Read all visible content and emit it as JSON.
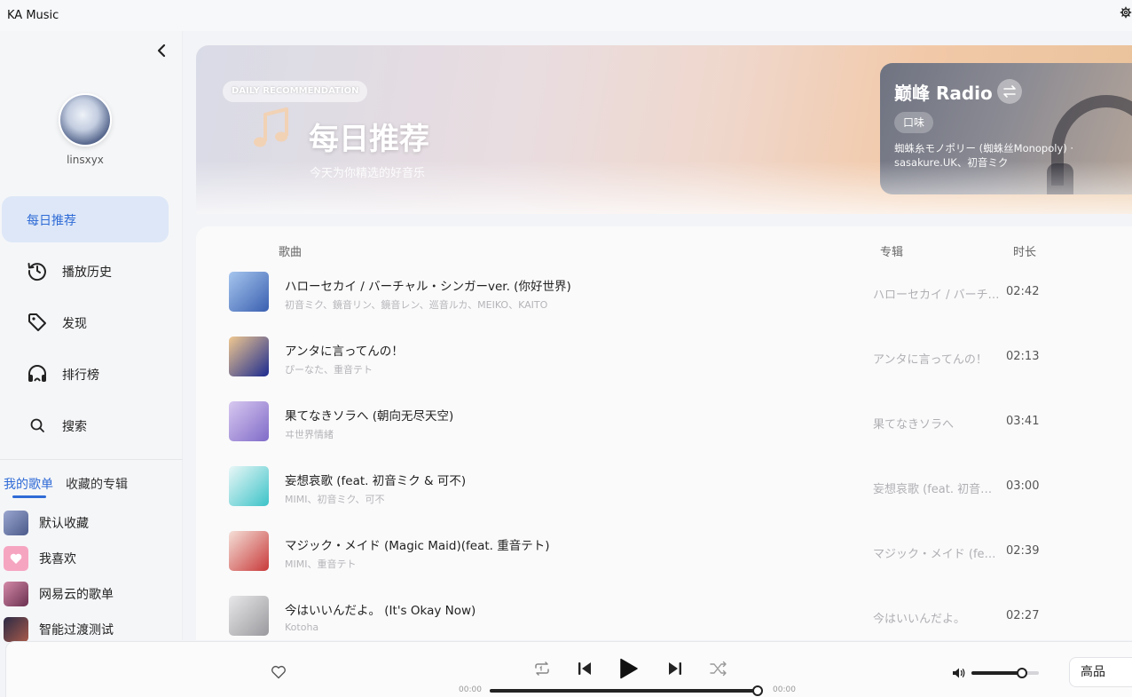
{
  "window": {
    "title": "KA Music"
  },
  "sidebar": {
    "username": "linsxyx",
    "nav": [
      {
        "label": "每日推荐",
        "icon": "none",
        "active": true
      },
      {
        "label": "播放历史",
        "icon": "history-icon"
      },
      {
        "label": "发现",
        "icon": "tag-icon"
      },
      {
        "label": "排行榜",
        "icon": "headset-icon"
      },
      {
        "label": "搜索",
        "icon": "search-icon"
      }
    ],
    "library_tabs": [
      {
        "label": "我的歌单",
        "active": true
      },
      {
        "label": "收藏的专辑"
      }
    ],
    "playlists": [
      {
        "name": "默认收藏",
        "thumb_color": "#6b7aa8"
      },
      {
        "name": "我喜欢",
        "thumb_color": "#f28bb0"
      },
      {
        "name": "网易云的歌单",
        "thumb_color": "#8a4a6e"
      },
      {
        "name": "智能过渡测试",
        "thumb_color": "#3b3a58"
      }
    ]
  },
  "banner": {
    "badge": "DAILY RECOMMENDATION",
    "title": "每日推荐",
    "subtitle": "今天为你精选的好音乐"
  },
  "radio": {
    "title": "巅峰 Radio",
    "taste_label": "口味",
    "song_line": "蜘蛛糸モノポリー (蜘蛛丝Monopoly) · sasakure.UK、初音ミク"
  },
  "song_list": {
    "headers": {
      "song": "歌曲",
      "album": "专辑",
      "duration": "时长"
    },
    "rows": [
      {
        "title": "ハローセカイ / バーチャル・シンガーver. (你好世界)",
        "artists": "初音ミク、鏡音リン、鏡音レン、巡音ルカ、MEIKO、KAITO",
        "album": "ハローセカイ / バーチャル・シンガーver.",
        "duration": "02:42",
        "cover": [
          "#3a5fb0",
          "#a6c6ee"
        ]
      },
      {
        "title": "アンタに言ってんの！",
        "artists": "ぴーなた、重音テト",
        "album": "アンタに言ってんの！",
        "duration": "02:13",
        "cover": [
          "#1b2a8f",
          "#f0c890"
        ]
      },
      {
        "title": "果てなきソラへ (朝向无尽天空)",
        "artists": "ヰ世界情緒",
        "album": "果てなきソラへ",
        "duration": "03:41",
        "cover": [
          "#7f6bc8",
          "#d8c8f0"
        ]
      },
      {
        "title": "妄想哀歌 (feat. 初音ミク & 可不)",
        "artists": "MIMI、初音ミク、可不",
        "album": "妄想哀歌 (feat. 初音ミク & 可不)",
        "duration": "03:00",
        "cover": [
          "#3cc3c8",
          "#eaf7f7"
        ]
      },
      {
        "title": "マジック・メイド (Magic Maid)(feat. 重音テト)",
        "artists": "MIMI、重音テト",
        "album": "マジック・メイド (feat. 重音テト)",
        "duration": "02:39",
        "cover": [
          "#c83a3a",
          "#f5e0d8"
        ]
      },
      {
        "title": "今はいいんだよ。 (It's Okay Now)",
        "artists": "Kotoha",
        "album": "今はいいんだよ。",
        "duration": "02:27",
        "cover": [
          "#9a9a9e",
          "#e8e8ea"
        ]
      }
    ]
  },
  "player": {
    "time_current": "00:00",
    "time_total": "00:00",
    "progress": 1.0,
    "volume": 0.75,
    "quality": "高品"
  },
  "colors": {
    "accent": "#2f6bd6",
    "active_nav_bg": "#dde7f7"
  }
}
